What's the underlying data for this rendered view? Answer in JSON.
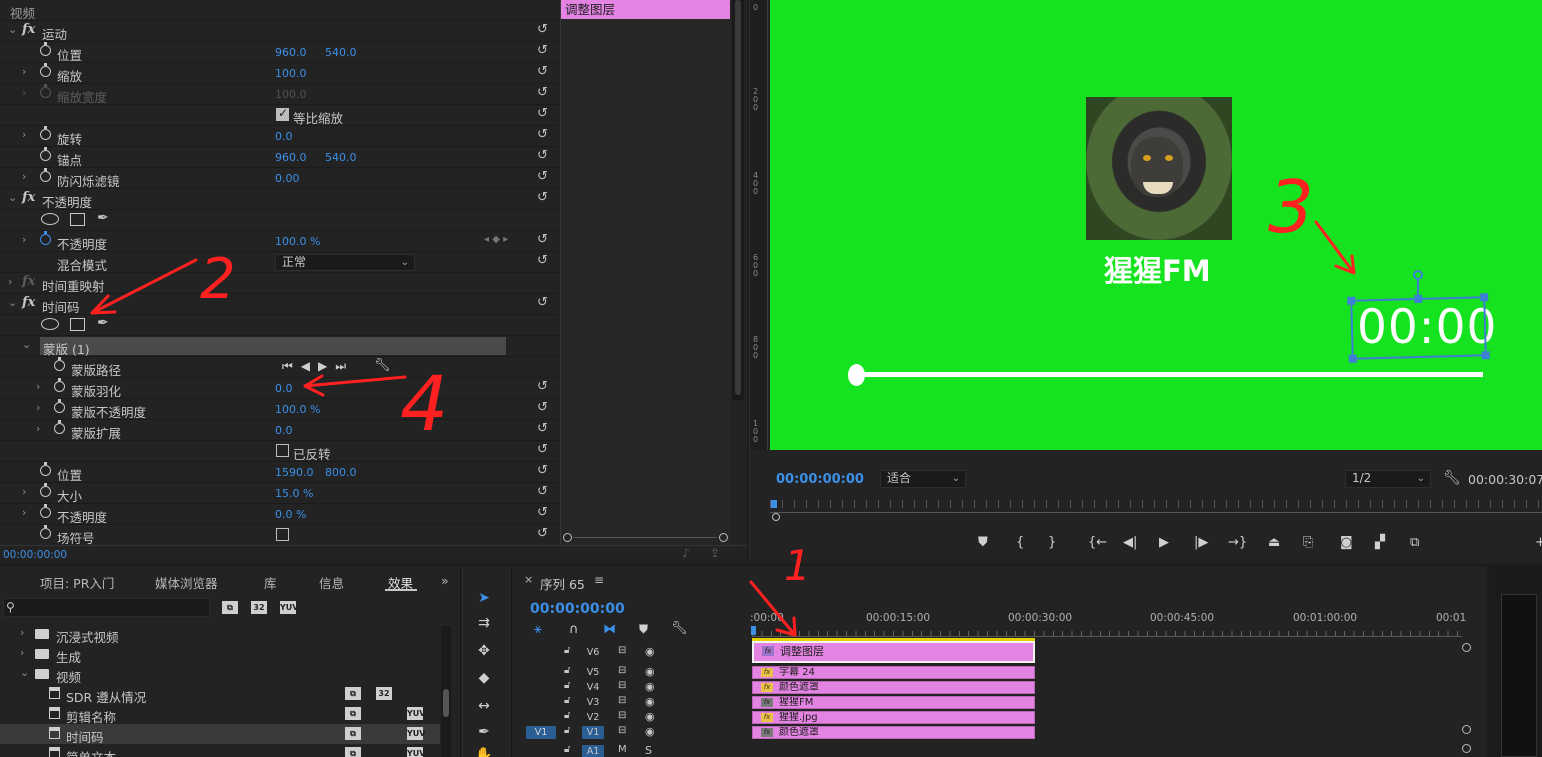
{
  "effect_controls": {
    "section_video": "视频",
    "motion": {
      "name": "运动",
      "position": {
        "label": "位置",
        "x": "960.0",
        "y": "540.0"
      },
      "scale": {
        "label": "缩放",
        "value": "100.0"
      },
      "scale_width": {
        "label": "缩放宽度",
        "value": "100.0"
      },
      "uniform_scale": {
        "label": "等比缩放",
        "checked": true
      },
      "rotation": {
        "label": "旋转",
        "value": "0.0"
      },
      "anchor": {
        "label": "锚点",
        "x": "960.0",
        "y": "540.0"
      },
      "anti_flicker": {
        "label": "防闪烁滤镜",
        "value": "0.00"
      }
    },
    "opacity": {
      "name": "不透明度",
      "opacity": {
        "label": "不透明度",
        "value": "100.0 %"
      },
      "blend_mode": {
        "label": "混合模式",
        "value": "正常"
      }
    },
    "time_remap": {
      "name": "时间重映射"
    },
    "timecode": {
      "name": "时间码",
      "mask": {
        "name": "蒙版 (1)",
        "path": {
          "label": "蒙版路径"
        },
        "feather": {
          "label": "蒙版羽化",
          "value": "0.0"
        },
        "mask_opacity": {
          "label": "蒙版不透明度",
          "value": "100.0 %"
        },
        "expansion": {
          "label": "蒙版扩展",
          "value": "0.0"
        },
        "inverted": {
          "label": "已反转",
          "checked": false
        }
      },
      "position": {
        "label": "位置",
        "x": "1590.0",
        "y": "800.0"
      },
      "size": {
        "label": "大小",
        "value": "15.0 %"
      },
      "opacity": {
        "label": "不透明度",
        "value": "0.0 %"
      },
      "field_symbol": {
        "label": "场符号"
      }
    },
    "clip_name": "调整图层",
    "current_time": "00:00:00:00"
  },
  "program_monitor": {
    "canvas_color": "#16e31f",
    "brand_text": "猩猩FM",
    "timecode_overlay": "00:00",
    "current_time": "00:00:00:00",
    "fit": "适合",
    "resolution": "1/2",
    "duration": "00:00:30:07",
    "ruler_marks": [
      "0",
      "2\n0\n0",
      "4\n0\n0",
      "6\n0\n0",
      "8\n0\n0",
      "1\n0\n0"
    ]
  },
  "project_panel": {
    "tabs": [
      "项目: PR入门",
      "媒体浏览器",
      "库",
      "信息",
      "效果"
    ],
    "active_tab": "效果",
    "search_placeholder": "",
    "badges": [
      "32",
      "YUV"
    ],
    "tree": [
      {
        "label": "沉浸式视频",
        "type": "folder",
        "expanded": false
      },
      {
        "label": "生成",
        "type": "folder",
        "expanded": false
      },
      {
        "label": "视频",
        "type": "folder",
        "expanded": true
      },
      {
        "label": "SDR 遵从情况",
        "type": "preset"
      },
      {
        "label": "剪辑名称",
        "type": "preset"
      },
      {
        "label": "时间码",
        "type": "preset",
        "selected": true
      },
      {
        "label": "简单文本",
        "type": "preset"
      }
    ]
  },
  "timeline": {
    "sequence_name": "序列 65",
    "current_time": "00:00:00:00",
    "ruler_labels": [
      ":00:00",
      "00:00:15:00",
      "00:00:30:00",
      "00:00:45:00",
      "00:01:00:00",
      "00:01"
    ],
    "tracks": [
      {
        "name": "V6",
        "clip": "调整图层",
        "fx": "purple"
      },
      {
        "name": "V5",
        "clip": "字幕 24",
        "fx": "yellow"
      },
      {
        "name": "V4",
        "clip": "颜色遮罩",
        "fx": "yellow"
      },
      {
        "name": "V3",
        "clip": "猩猩FM",
        "fx": "grey"
      },
      {
        "name": "V2",
        "clip": "猩猩.jpg",
        "fx": "yellow"
      },
      {
        "name": "V1",
        "clip": "颜色遮罩",
        "fx": "grey"
      },
      {
        "name": "A1",
        "clip": "",
        "fx": ""
      }
    ],
    "source_patch": "V1"
  },
  "annotations": [
    "1",
    "2",
    "3",
    "4"
  ]
}
